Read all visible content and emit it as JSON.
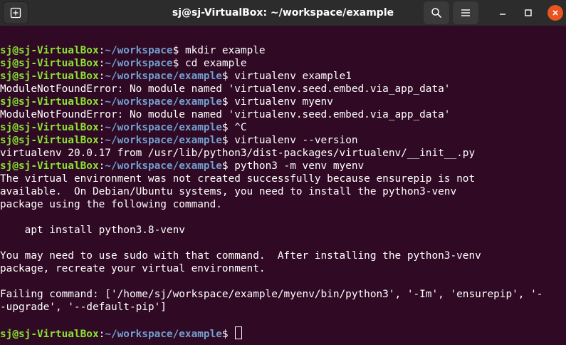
{
  "window": {
    "title": "sj@sj-VirtualBox: ~/workspace/example"
  },
  "titlebar": {
    "icons": {
      "new_tab": "new-tab-icon",
      "search": "search-icon",
      "menu": "hamburger-menu-icon",
      "minimize": "minimize-icon",
      "maximize": "maximize-icon",
      "close": "close-icon"
    },
    "colors": {
      "background": "#2c2c2c",
      "close_button": "#e95420"
    }
  },
  "colors": {
    "terminal_background": "#300a24",
    "prompt_user": "#8ae234",
    "prompt_path": "#729fcf",
    "text": "#ffffff"
  },
  "terminal": {
    "lines": [
      {
        "type": "prompt",
        "user": "sj@sj-VirtualBox",
        "sep": ":",
        "path": "~/workspace",
        "symbol": "$ ",
        "cmd": "mkdir example"
      },
      {
        "type": "prompt",
        "user": "sj@sj-VirtualBox",
        "sep": ":",
        "path": "~/workspace",
        "symbol": "$ ",
        "cmd": "cd example"
      },
      {
        "type": "prompt",
        "user": "sj@sj-VirtualBox",
        "sep": ":",
        "path": "~/workspace/example",
        "symbol": "$ ",
        "cmd": "virtualenv example1"
      },
      {
        "type": "output",
        "text": "ModuleNotFoundError: No module named 'virtualenv.seed.embed.via_app_data'"
      },
      {
        "type": "prompt",
        "user": "sj@sj-VirtualBox",
        "sep": ":",
        "path": "~/workspace/example",
        "symbol": "$ ",
        "cmd": "virtualenv myenv"
      },
      {
        "type": "output",
        "text": "ModuleNotFoundError: No module named 'virtualenv.seed.embed.via_app_data'"
      },
      {
        "type": "prompt",
        "user": "sj@sj-VirtualBox",
        "sep": ":",
        "path": "~/workspace/example",
        "symbol": "$ ",
        "cmd": "^C"
      },
      {
        "type": "prompt",
        "user": "sj@sj-VirtualBox",
        "sep": ":",
        "path": "~/workspace/example",
        "symbol": "$ ",
        "cmd": "virtualenv --version"
      },
      {
        "type": "output",
        "text": "virtualenv 20.0.17 from /usr/lib/python3/dist-packages/virtualenv/__init__.py"
      },
      {
        "type": "prompt",
        "user": "sj@sj-VirtualBox",
        "sep": ":",
        "path": "~/workspace/example",
        "symbol": "$ ",
        "cmd": "python3 -m venv myenv"
      },
      {
        "type": "output",
        "text": "The virtual environment was not created successfully because ensurepip is not"
      },
      {
        "type": "output",
        "text": "available.  On Debian/Ubuntu systems, you need to install the python3-venv"
      },
      {
        "type": "output",
        "text": "package using the following command."
      },
      {
        "type": "output",
        "text": ""
      },
      {
        "type": "output",
        "text": "    apt install python3.8-venv"
      },
      {
        "type": "output",
        "text": ""
      },
      {
        "type": "output",
        "text": "You may need to use sudo with that command.  After installing the python3-venv"
      },
      {
        "type": "output",
        "text": "package, recreate your virtual environment."
      },
      {
        "type": "output",
        "text": ""
      },
      {
        "type": "output",
        "text": "Failing command: ['/home/sj/workspace/example/myenv/bin/python3', '-Im', 'ensurepip', '-"
      },
      {
        "type": "output",
        "text": "-upgrade', '--default-pip']"
      },
      {
        "type": "output",
        "text": ""
      },
      {
        "type": "prompt",
        "user": "sj@sj-VirtualBox",
        "sep": ":",
        "path": "~/workspace/example",
        "symbol": "$ ",
        "cmd": "",
        "cursor": true
      }
    ]
  }
}
